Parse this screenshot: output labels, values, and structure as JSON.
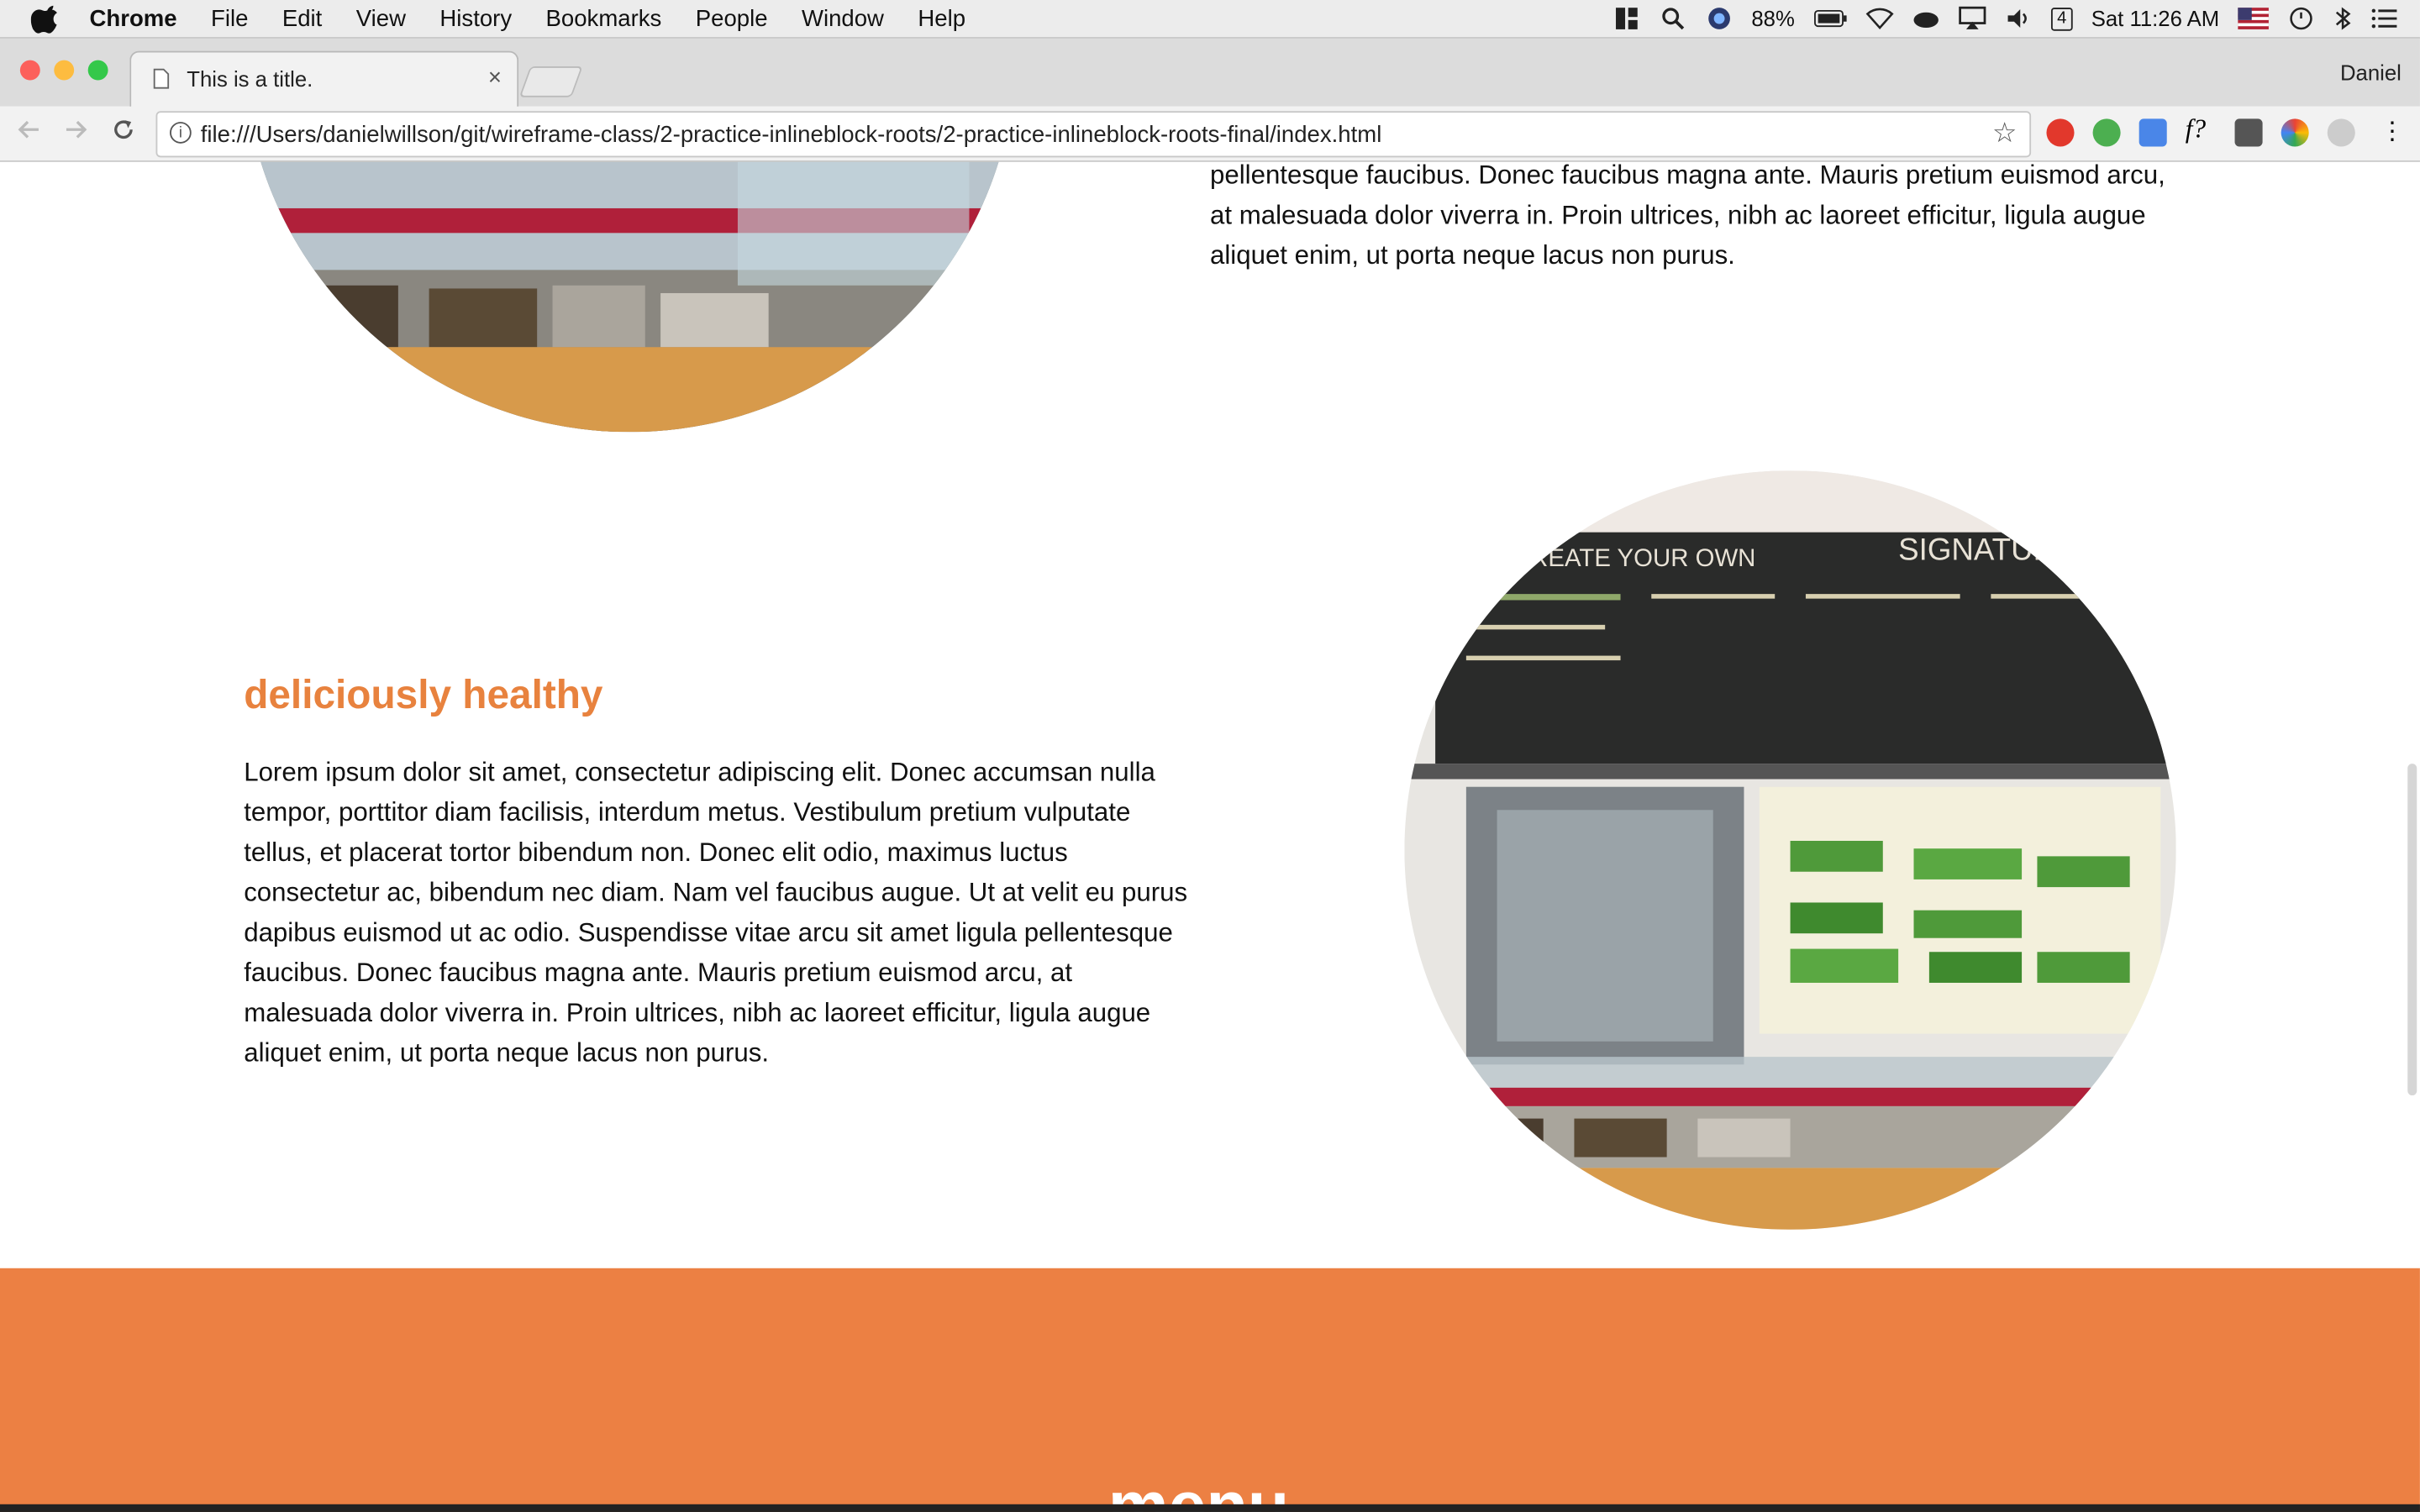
{
  "menubar": {
    "app": "Chrome",
    "items": [
      "File",
      "Edit",
      "View",
      "History",
      "Bookmarks",
      "People",
      "Window",
      "Help"
    ],
    "battery": "88%",
    "clock": "Sat 11:26 AM",
    "calendar_day": "4"
  },
  "tab": {
    "title": "This is a title.",
    "close": "×"
  },
  "profile": "Daniel",
  "omnibox": {
    "url": "file:///Users/danielwillson/git/wireframe-class/2-practice-inlineblock-roots/2-practice-inlineblock-roots-final/index.html"
  },
  "page": {
    "top_text": "pellentesque faucibus. Donec faucibus magna ante. Mauris pretium euismod arcu, at malesuada dolor viverra in. Proin ultrices, nibh ac laoreet efficitur, ligula augue aliquet enim, ut porta neque lacus non purus.",
    "heading": "deliciously healthy",
    "body": "Lorem ipsum dolor sit amet, consectetur adipiscing elit. Donec accumsan nulla tempor, porttitor diam facilisis, interdum metus. Vestibulum pretium vulputate tellus, et placerat tortor bibendum non. Donec elit odio, maximus luctus consectetur ac, bibendum nec diam. Nam vel faucibus augue. Ut at velit eu purus dapibus euismod ut ac odio. Suspendisse vitae arcu sit amet ligula pellentesque faucibus. Donec faucibus magna ante. Mauris pretium euismod arcu, at malesuada dolor viverra in. Proin ultrices, nibh ac laoreet efficitur, ligula augue aliquet enim, ut porta neque lacus non purus.",
    "board": {
      "left_title": "CREATE YOUR OWN",
      "right_title": "SIGNATURE"
    },
    "section_title": "menu"
  },
  "colors": {
    "accent": "#ec8043",
    "heading": "#e8823e"
  }
}
